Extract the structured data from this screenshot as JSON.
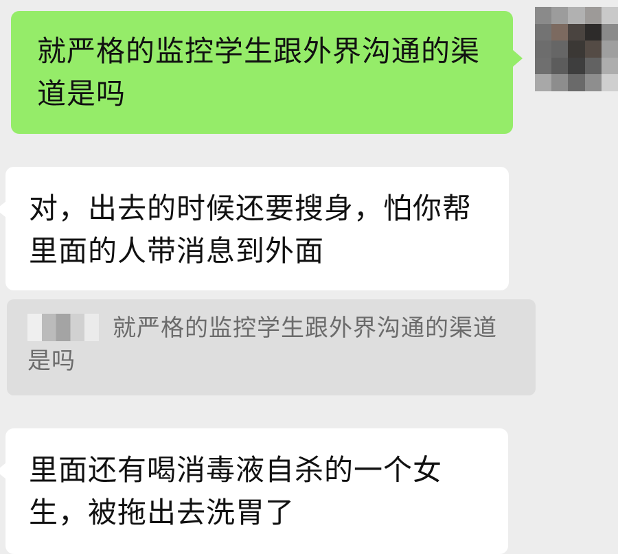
{
  "messages": {
    "sent_1": {
      "text": "就严格的监控学生跟外界沟通的渠道是吗"
    },
    "received_1": {
      "text": "对，出去的时候还要搜身，怕你帮里面的人带消息到外面"
    },
    "quote_reply": {
      "text": "就严格的监控学生跟外界沟通的渠道是吗"
    },
    "received_2": {
      "text": "里面还有喝消毒液自杀的一个女生，被拖出去洗胃了"
    }
  },
  "colors": {
    "chat_background": "#ededed",
    "sent_bubble": "#95ec69",
    "received_bubble": "#ffffff",
    "quote_background": "#dedede",
    "quote_text": "#6b6b6b"
  }
}
